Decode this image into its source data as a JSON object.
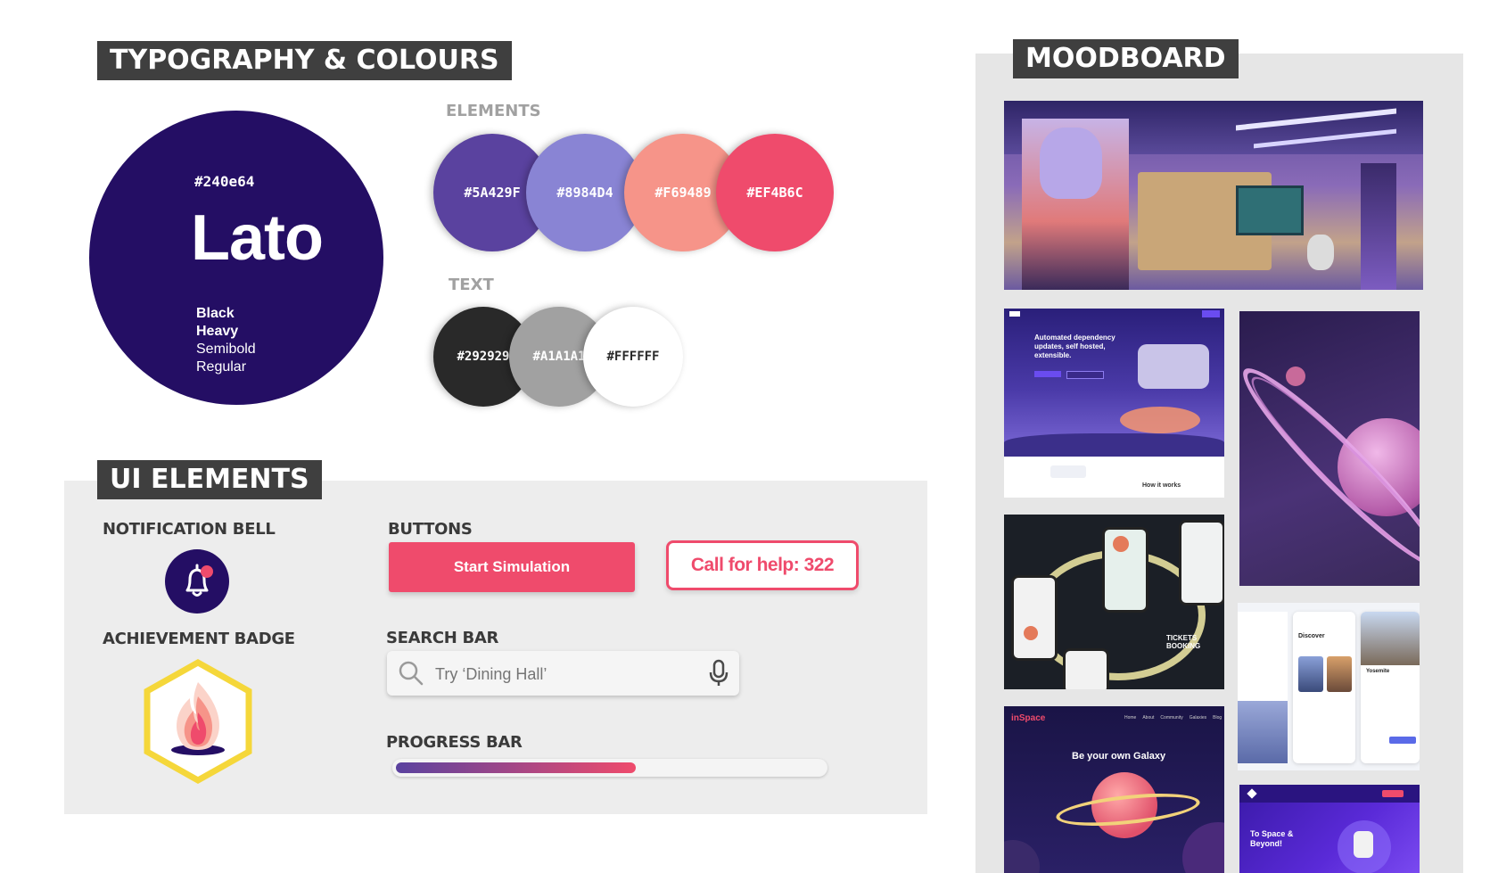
{
  "typography": {
    "title": "TYPOGRAPHY & COLOURS",
    "font_hex": "#240e64",
    "font_name": "Lato",
    "weights": [
      "Black",
      "Heavy",
      "Semibold",
      "Regular"
    ]
  },
  "colours": {
    "elements_label": "ELEMENTS",
    "elements": [
      "#5A429F",
      "#8984D4",
      "#F69489",
      "#EF4B6C"
    ],
    "text_label": "TEXT",
    "text": [
      "#292929",
      "#A1A1A1",
      "#FFFFFF"
    ]
  },
  "ui_elements": {
    "title": "UI ELEMENTS",
    "notification_label": "NOTIFICATION BELL",
    "achievement_label": "ACHIEVEMENT BADGE",
    "buttons_label": "BUTTONS",
    "primary_button": "Start Simulation",
    "secondary_button": "Call for help: 322",
    "search_label": "SEARCH BAR",
    "search_placeholder": "Try ‘Dining Hall’",
    "progress_label": "PROGRESS BAR",
    "progress_value": 0.56
  },
  "moodboard": {
    "title": "MOODBOARD",
    "tile2_headline": "Automated dependency updates, self hosted, extensible.",
    "tile2_footer": "How it works",
    "tile4_caption": "TICKETS BOOKING",
    "tile5_brand": "inSpace",
    "tile5_nav": [
      "Home",
      "About",
      "Community",
      "Galaxies",
      "Blog"
    ],
    "tile5_headline": "Be your own Galaxy",
    "tile6_discover": "Discover",
    "tile6_place": "Yosemite",
    "tile7_headline": "To Space & Beyond!"
  },
  "colors": {
    "accent": "#ef4b6c",
    "dark_navy": "#240e64",
    "purple": "#5a429f",
    "lavender": "#8984d4",
    "salmon": "#f69489"
  },
  "icons": {
    "search": "search-icon",
    "mic": "microphone-icon",
    "bell": "bell-icon",
    "badge": "flame-icon"
  }
}
